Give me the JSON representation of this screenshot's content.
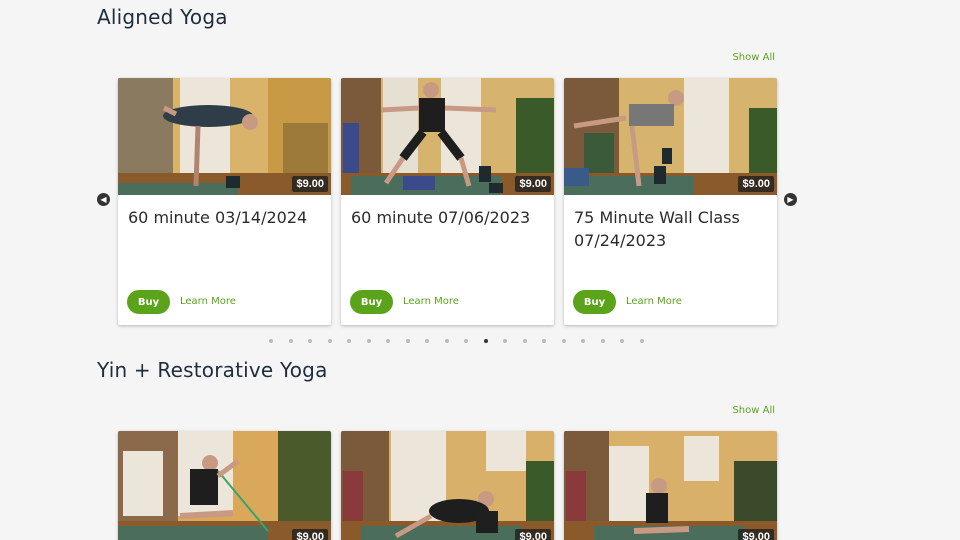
{
  "sections": [
    {
      "title": "Aligned Yoga",
      "show_all": "Show All",
      "cards": [
        {
          "title": "60 minute 03/14/2024",
          "price": "$9.00",
          "buy": "Buy",
          "learn": "Learn More"
        },
        {
          "title": "60 minute 07/06/2023",
          "price": "$9.00",
          "buy": "Buy",
          "learn": "Learn More"
        },
        {
          "title": "75 Minute Wall Class 07/24/2023",
          "price": "$9.00",
          "buy": "Buy",
          "learn": "Learn More"
        }
      ],
      "carousel": {
        "page_count": 20,
        "active_page": 11
      }
    },
    {
      "title": "Yin + Restorative Yoga",
      "show_all": "Show All",
      "cards": [
        {
          "price": "$9.00"
        },
        {
          "price": "$9.00"
        },
        {
          "price": "$9.00"
        }
      ]
    }
  ],
  "icons": {
    "prev": "chevron-left-icon",
    "next": "chevron-right-icon"
  },
  "colors": {
    "accent": "#5aa31a",
    "title": "#1f2d3d",
    "background": "#f5f5f5"
  }
}
